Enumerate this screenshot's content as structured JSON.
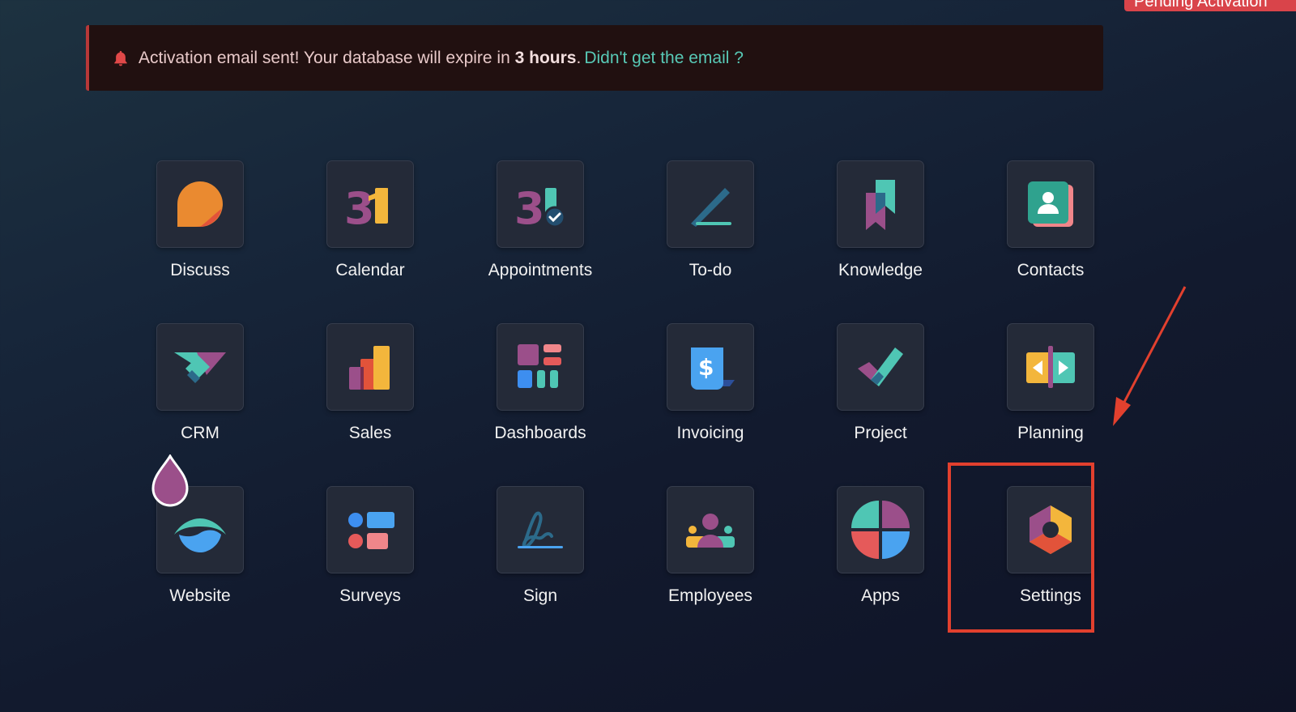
{
  "pending_button": {
    "label": "Pending Activation"
  },
  "banner": {
    "text_before": "Activation email sent! Your database will expire in",
    "hours": "3 hours",
    "period": ".",
    "link": "Didn't get the email ?",
    "icon": "bell-icon"
  },
  "apps": [
    {
      "label": "Discuss",
      "icon": "discuss-icon"
    },
    {
      "label": "Calendar",
      "icon": "calendar-icon"
    },
    {
      "label": "Appointments",
      "icon": "appointments-icon"
    },
    {
      "label": "To-do",
      "icon": "todo-icon"
    },
    {
      "label": "Knowledge",
      "icon": "knowledge-icon"
    },
    {
      "label": "Contacts",
      "icon": "contacts-icon"
    },
    {
      "label": "CRM",
      "icon": "crm-icon"
    },
    {
      "label": "Sales",
      "icon": "sales-icon"
    },
    {
      "label": "Dashboards",
      "icon": "dashboards-icon"
    },
    {
      "label": "Invoicing",
      "icon": "invoicing-icon"
    },
    {
      "label": "Project",
      "icon": "project-icon"
    },
    {
      "label": "Planning",
      "icon": "planning-icon"
    },
    {
      "label": "Website",
      "icon": "website-icon"
    },
    {
      "label": "Surveys",
      "icon": "surveys-icon"
    },
    {
      "label": "Sign",
      "icon": "sign-icon"
    },
    {
      "label": "Employees",
      "icon": "employees-icon"
    },
    {
      "label": "Apps",
      "icon": "apps-icon"
    },
    {
      "label": "Settings",
      "icon": "settings-icon"
    }
  ],
  "annotation": {
    "highlight_color": "#e2402e"
  }
}
